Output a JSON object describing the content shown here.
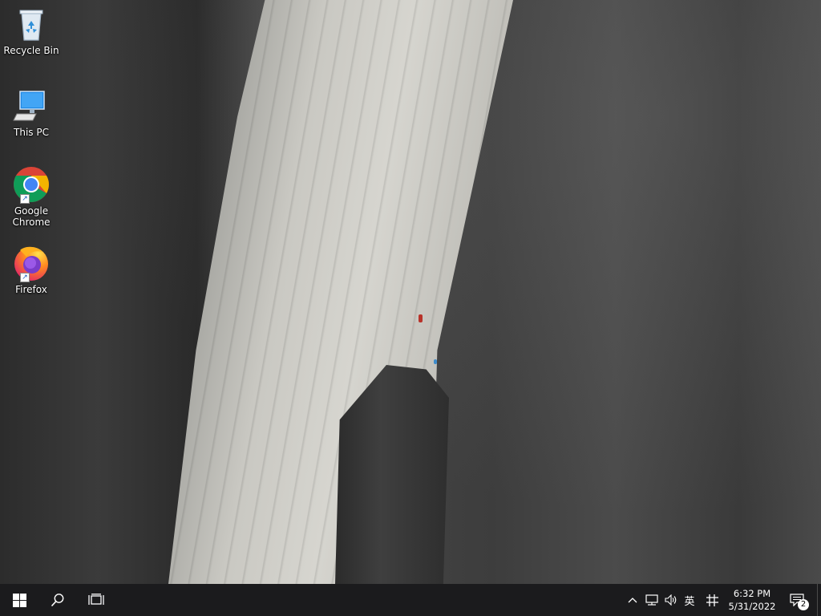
{
  "desktop": {
    "icons": [
      {
        "id": "recycle-bin",
        "label": "Recycle Bin",
        "icon": "recycle-bin-icon"
      },
      {
        "id": "this-pc",
        "label": "This PC",
        "icon": "computer-icon"
      },
      {
        "id": "google-chrome",
        "label": "Google Chrome",
        "icon": "chrome-icon"
      },
      {
        "id": "firefox",
        "label": "Firefox",
        "icon": "firefox-icon"
      }
    ]
  },
  "taskbar": {
    "start_icon": "windows-start-icon",
    "search_icon": "search-icon",
    "task_view_icon": "task-view-icon",
    "tray": {
      "chevron_icon": "chevron-up-icon",
      "network_icon": "network-icon",
      "volume_icon": "volume-icon",
      "ime_mode": "英",
      "ime_icon": "ime-grid-icon"
    },
    "clock": {
      "time": "6:32 PM",
      "date": "5/31/2022"
    },
    "notifications": {
      "icon": "action-center-icon",
      "count": "2"
    }
  },
  "colors": {
    "taskbar_bg": "#1b1b1d",
    "chrome_red": "#db4437",
    "chrome_yellow": "#f4b400",
    "chrome_green": "#0f9d58",
    "chrome_blue": "#4285f4"
  }
}
